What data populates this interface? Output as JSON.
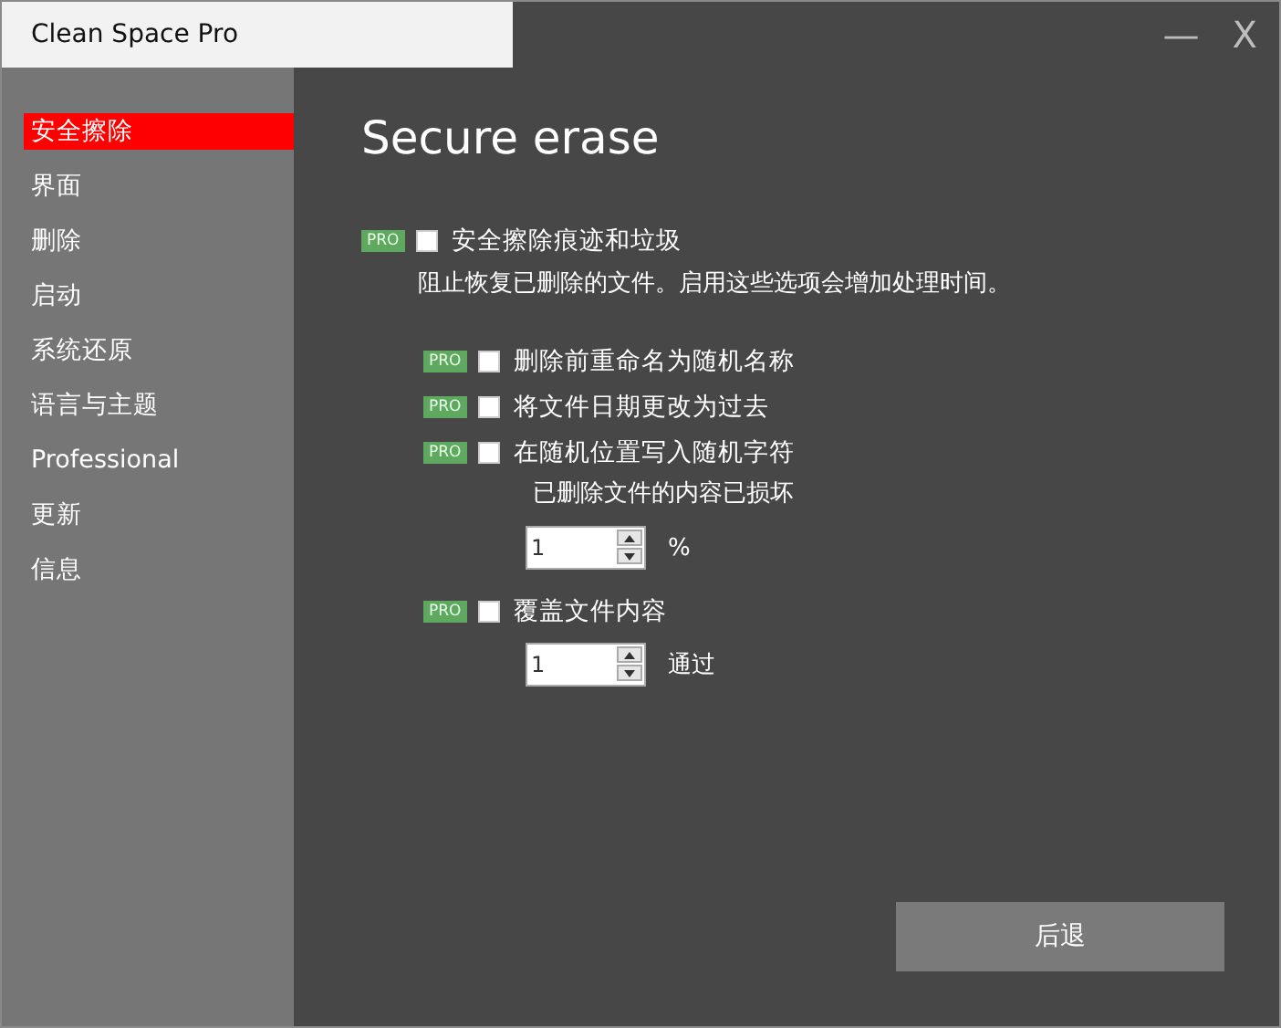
{
  "window": {
    "title": "Clean Space Pro",
    "controls": [
      "—",
      "X"
    ]
  },
  "sidebar": {
    "items": [
      {
        "label": "安全擦除",
        "selected": true
      },
      {
        "label": "界面",
        "selected": false
      },
      {
        "label": "删除",
        "selected": false
      },
      {
        "label": "启动",
        "selected": false
      },
      {
        "label": "系统还原",
        "selected": false
      },
      {
        "label": "语言与主题",
        "selected": false
      },
      {
        "label": "Professional",
        "selected": false
      },
      {
        "label": "更新",
        "selected": false
      },
      {
        "label": "信息",
        "selected": false
      }
    ]
  },
  "page": {
    "heading": "Secure erase",
    "option": {
      "badge": "PRO",
      "checked": false,
      "label": "安全擦除痕迹和垃圾",
      "description": "阻止恢复已删除的文件。启用这些选项会增加处理时间。",
      "children": [
        {
          "badge": "PRO",
          "checked": false,
          "label": "删除前重命名为随机名称"
        },
        {
          "badge": "PRO",
          "checked": false,
          "label": "将文件日期更改为过去"
        },
        {
          "badge": "PRO",
          "checked": false,
          "label": "在随机位置写入随机字符",
          "note": "已删除文件的内容已损坏",
          "spinner": {
            "value": "1",
            "unit": "%"
          }
        },
        {
          "badge": "PRO",
          "checked": false,
          "label": "覆盖文件内容",
          "spinner": {
            "value": "1",
            "unit": "通过"
          }
        }
      ]
    }
  },
  "buttons": [
    "后退"
  ]
}
